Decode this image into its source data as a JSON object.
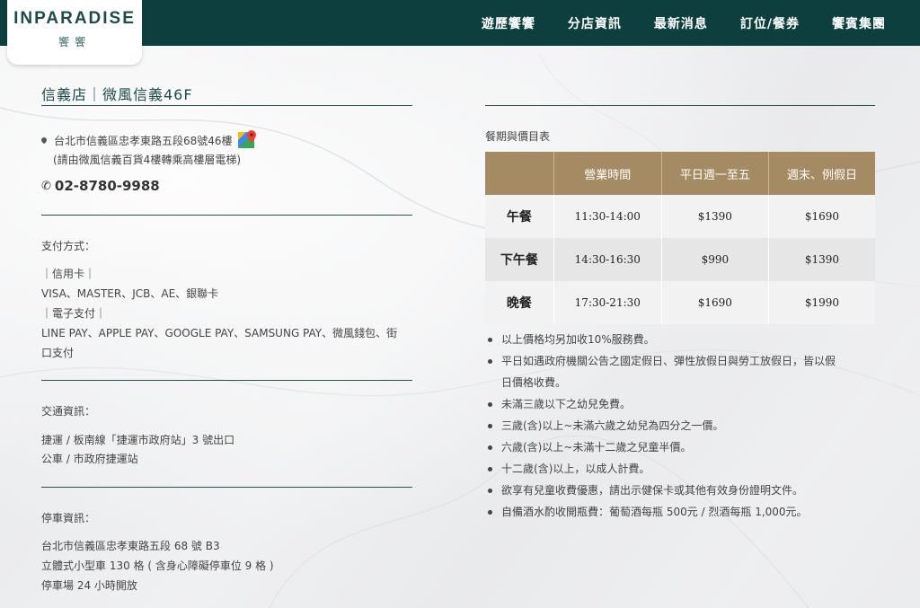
{
  "header": {
    "logo_main": "INPARADISE",
    "logo_sub": "饗饗",
    "nav": [
      "遊歷饗饗",
      "分店資訊",
      "最新消息",
      "訂位/餐券",
      "饗賓集團"
    ]
  },
  "store": {
    "title": "信義店｜微風信義46F",
    "address": "台北市信義區忠孝東路五段68號46樓",
    "address_note": "(請由微風信義百貨4樓轉乘高樓層電梯)",
    "phone": "02-8780-9988"
  },
  "payment": {
    "label": "支付方式：",
    "lines": [
      "｜信用卡｜",
      "VISA、MASTER、JCB、AE、銀聯卡",
      "｜電子支付｜",
      "LINE PAY、APPLE PAY、GOOGLE PAY、SAMSUNG PAY、微風錢包、街",
      "口支付"
    ]
  },
  "transport": {
    "label": "交通資訊：",
    "lines": [
      "捷運 / 板南線「捷運市政府站」3 號出口",
      "公車 / 市政府捷運站"
    ]
  },
  "parking": {
    "label": "停車資訊：",
    "lines": [
      "台北市信義區忠孝東路五段 68 號 B3",
      "立體式小型車 130 格 ( 含身心障礙停車位 9 格 )",
      "停車場 24 小時開放"
    ]
  },
  "menu": {
    "title": "餐期與價目表",
    "headers": [
      "",
      "營業時間",
      "平日週一至五",
      "週末、例假日"
    ],
    "rows": [
      [
        "午餐",
        "11:30-14:00",
        "$1390",
        "$1690"
      ],
      [
        "下午餐",
        "14:30-16:30",
        "$990",
        "$1390"
      ],
      [
        "晚餐",
        "17:30-21:30",
        "$1690",
        "$1990"
      ]
    ],
    "notes": [
      "以上價格均另加收10%服務費。",
      "平日如遇政府機關公告之國定假日、彈性放假日與勞工放假日，皆以假",
      "日價格收費。",
      "未滿三歲以下之幼兒免費。",
      "三歲(含)以上~未滿六歲之幼兒為四分之一價。",
      "六歲(含)以上~未滿十二歲之兒童半價。",
      "十二歲(含)以上，以成人計費。",
      "欲享有兒童收費優惠，請出示健保卡或其他有效身份證明文件。",
      "自備酒水酌收開瓶費：葡萄酒每瓶 500元 / 烈酒每瓶 1,000元。"
    ]
  },
  "colors": {
    "header_bg": "#0d3f3f",
    "table_header": "#a58b63",
    "accent_text": "#1d4a4a"
  },
  "icons": [
    "map-pin-icon",
    "google-maps-icon",
    "phone-icon"
  ]
}
